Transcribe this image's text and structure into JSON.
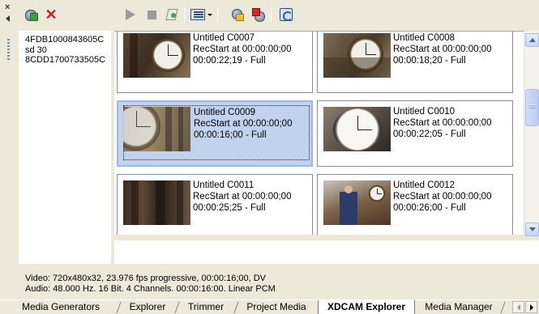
{
  "window": {
    "close_glyph": "×"
  },
  "toolbar": {
    "buttons": [
      {
        "name": "import-media-button",
        "icon": "import-icon"
      },
      {
        "name": "delete-button",
        "icon": "delete-x-icon"
      },
      {
        "name": "play-button",
        "icon": "play-icon"
      },
      {
        "name": "stop-button",
        "icon": "stop-icon"
      },
      {
        "name": "auto-preview-button",
        "icon": "auto-preview-icon"
      },
      {
        "name": "views-button",
        "icon": "views-icon"
      },
      {
        "name": "get-media-button",
        "icon": "get-media-icon"
      },
      {
        "name": "export-media-button",
        "icon": "export-media-icon"
      },
      {
        "name": "refresh-button",
        "icon": "refresh-icon"
      }
    ],
    "delete_glyph": "✕"
  },
  "device_list": {
    "items": [
      "4FDB1000843605C",
      "sd 30",
      "8CDD1700733505C"
    ]
  },
  "clips": [
    {
      "title": "Untitled C0007",
      "recstart": "RecStart at 00:00:00;00",
      "duration": "00:00:22;19 - Full",
      "selected": false
    },
    {
      "title": "Untitled C0008",
      "recstart": "RecStart at 00:00:00;00",
      "duration": "00:00:18;20 - Full",
      "selected": false
    },
    {
      "title": "Untitled C0009",
      "recstart": "RecStart at 00:00:00;00",
      "duration": "00:00:16;00 - Full",
      "selected": true
    },
    {
      "title": "Untitled C0010",
      "recstart": "RecStart at 00:00:00;00",
      "duration": "00:00:22;05 - Full",
      "selected": false
    },
    {
      "title": "Untitled C0011",
      "recstart": "RecStart at 00:00:00;00",
      "duration": "00:00:25;25 - Full",
      "selected": false
    },
    {
      "title": "Untitled C0012",
      "recstart": "RecStart at 00:00:00;00",
      "duration": "00:00:26;00 - Full",
      "selected": false
    }
  ],
  "info": {
    "video": "Video: 720x480x32, 23.976 fps progressive, 00:00:16;00, DV",
    "audio": "Audio: 48.000 Hz. 16 Bit. 4 Channels. 00:00:16:00. Linear PCM"
  },
  "tabs": [
    {
      "label": "Media Generators",
      "active": false
    },
    {
      "label": "Explorer",
      "active": false
    },
    {
      "label": "Trimmer",
      "active": false
    },
    {
      "label": "Project Media",
      "active": false
    },
    {
      "label": "XDCAM Explorer",
      "active": true
    },
    {
      "label": "Media Manager",
      "active": false
    }
  ],
  "colors": {
    "selection": "#c1d2ee",
    "delete_red": "#d31e1e",
    "panel_bg": "#ece9d8"
  }
}
